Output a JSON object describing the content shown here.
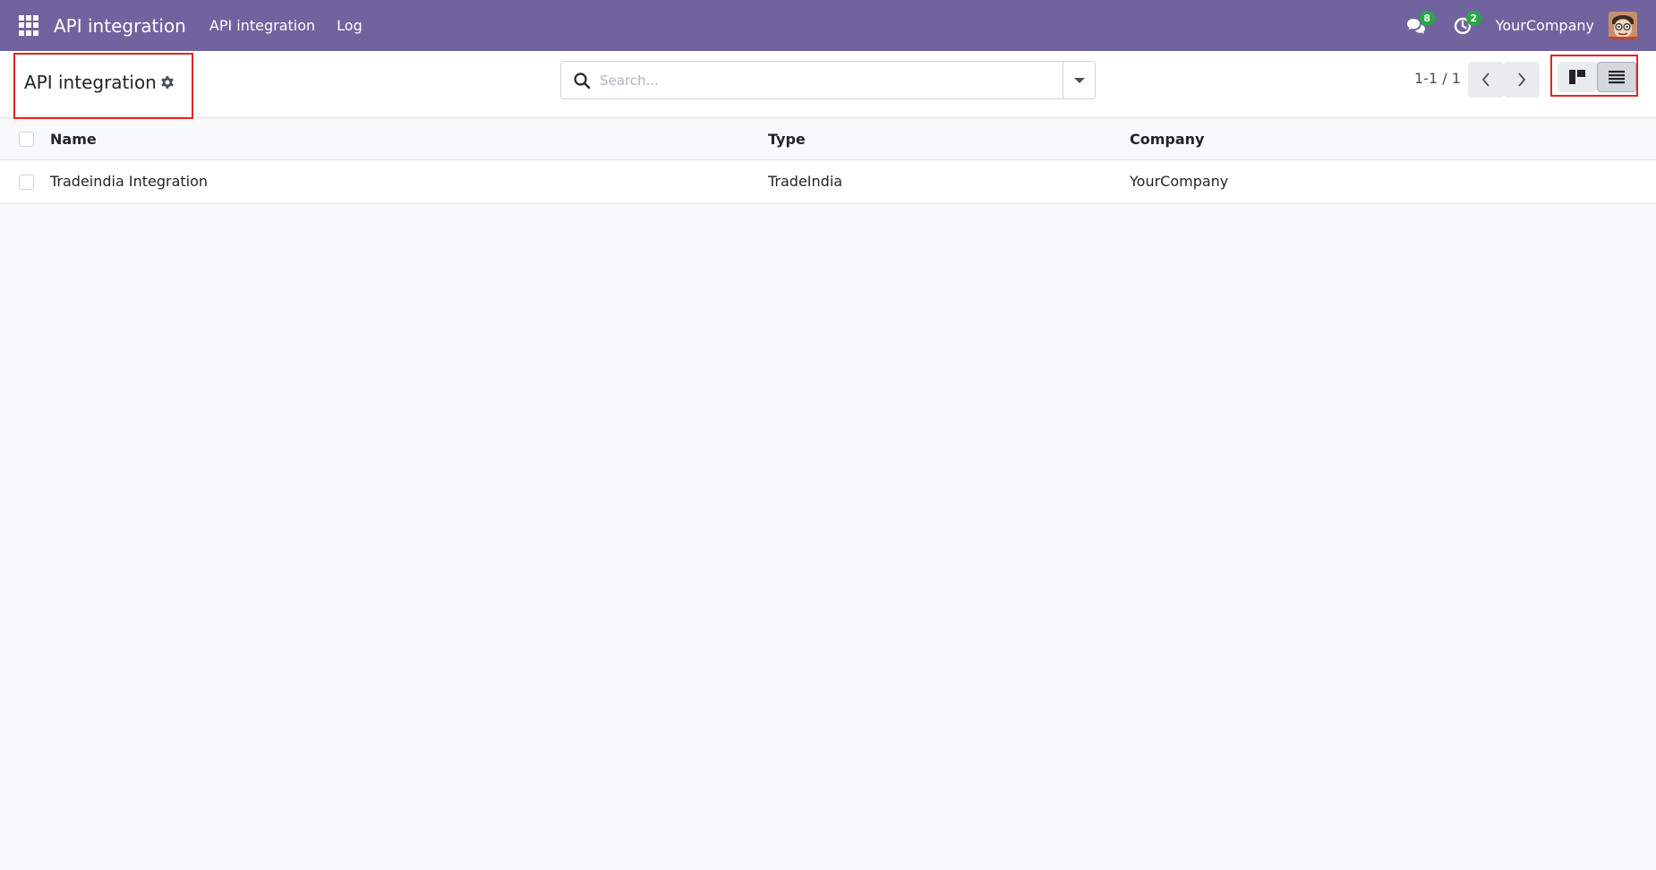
{
  "navbar": {
    "brand": "API integration",
    "menu": [
      "API integration",
      "Log"
    ],
    "messages_count": "8",
    "activities_count": "2",
    "company": "YourCompany"
  },
  "control_panel": {
    "title": "API integration",
    "search_placeholder": "Search...",
    "pager": "1-1 / 1"
  },
  "list": {
    "columns": [
      "Name",
      "Type",
      "Company"
    ],
    "rows": [
      {
        "name": "Tradeindia Integration",
        "type": "TradeIndia",
        "company": "YourCompany"
      }
    ]
  },
  "icons": {
    "apps": "apps-grid-icon",
    "messages": "chat-icon",
    "activities": "clock-icon",
    "settings": "gear-icon",
    "search": "search-icon",
    "kanban": "kanban-view-icon",
    "list": "list-view-icon"
  },
  "colors": {
    "navbar": "#71639e",
    "badge": "#28a745",
    "highlight": "#e02424"
  }
}
